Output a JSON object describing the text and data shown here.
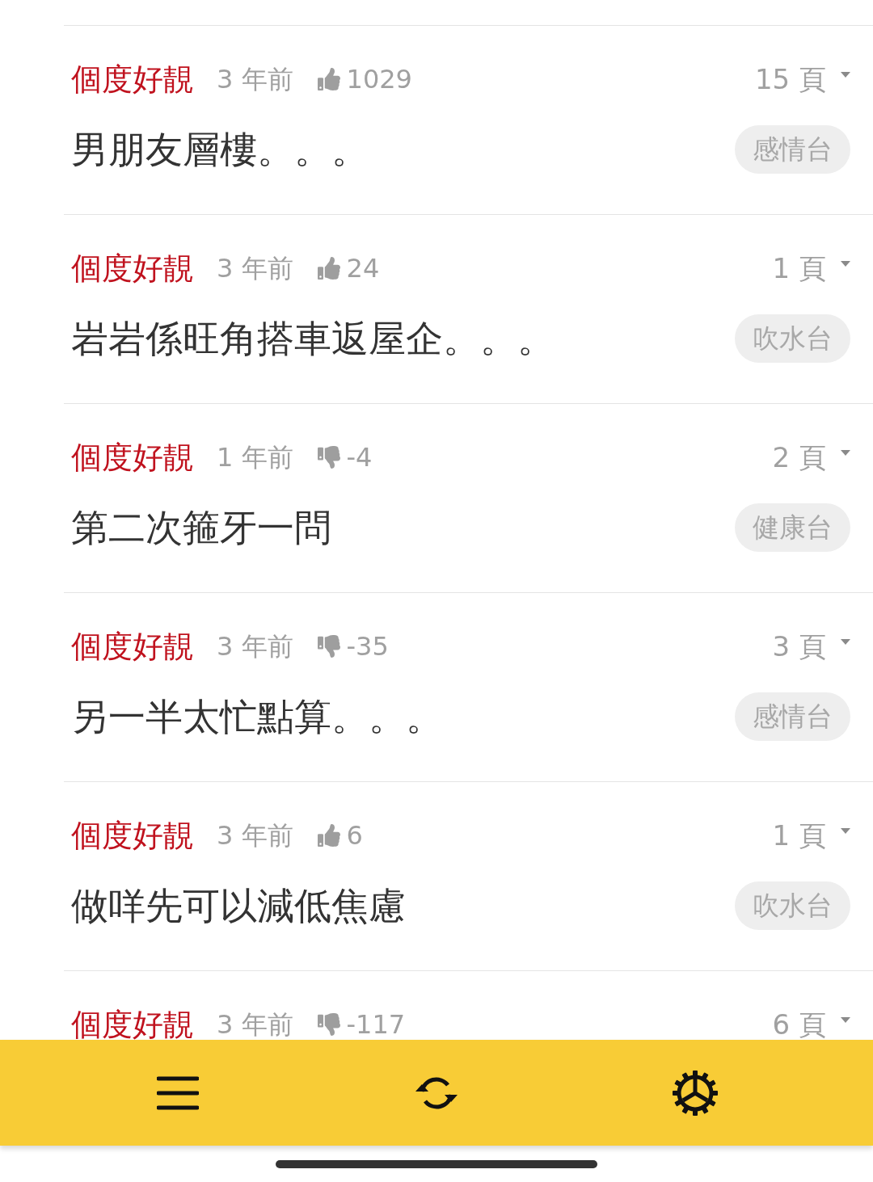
{
  "posts": [
    {
      "author": "個度好靚",
      "time": "3 年前",
      "vote": {
        "kind": "up",
        "count": "1029"
      },
      "pages": "15 頁",
      "title": "男朋友層樓。。。",
      "board": "感情台"
    },
    {
      "author": "個度好靚",
      "time": "3 年前",
      "vote": {
        "kind": "up",
        "count": "24"
      },
      "pages": "1 頁",
      "title": "岩岩係旺角搭車返屋企。。。",
      "board": "吹水台"
    },
    {
      "author": "個度好靚",
      "time": "1 年前",
      "vote": {
        "kind": "down",
        "count": "-4"
      },
      "pages": "2 頁",
      "title": "第二次箍牙一問",
      "board": "健康台"
    },
    {
      "author": "個度好靚",
      "time": "3 年前",
      "vote": {
        "kind": "down",
        "count": "-35"
      },
      "pages": "3 頁",
      "title": "另一半太忙點算。。。",
      "board": "感情台"
    },
    {
      "author": "個度好靚",
      "time": "3 年前",
      "vote": {
        "kind": "up",
        "count": "6"
      },
      "pages": "1 頁",
      "title": "做咩先可以減低焦慮",
      "board": "吹水台"
    },
    {
      "author": "個度好靚",
      "time": "3 年前",
      "vote": {
        "kind": "down",
        "count": "-117"
      },
      "pages": "6 頁"
    }
  ]
}
